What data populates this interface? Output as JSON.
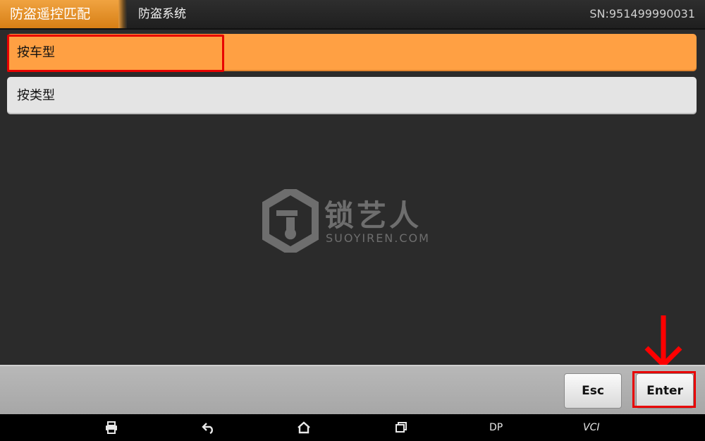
{
  "header": {
    "active_tab": "防盗遥控匹配",
    "breadcrumb": "防盗系统",
    "serial": "SN:951499990031"
  },
  "menu": {
    "items": [
      {
        "label": "按车型",
        "selected": true
      },
      {
        "label": "按类型",
        "selected": false
      }
    ]
  },
  "watermark": {
    "cn": "锁艺人",
    "en": "SUOYIREN.COM"
  },
  "actions": {
    "esc_label": "Esc",
    "enter_label": "Enter"
  },
  "navbar": {
    "icons": [
      "print-icon",
      "back-icon",
      "home-icon",
      "recent-apps-icon"
    ],
    "dp_label": "DP",
    "vci_label": "VCI"
  },
  "colors": {
    "accent": "#ffa043",
    "highlight": "#e80000"
  }
}
